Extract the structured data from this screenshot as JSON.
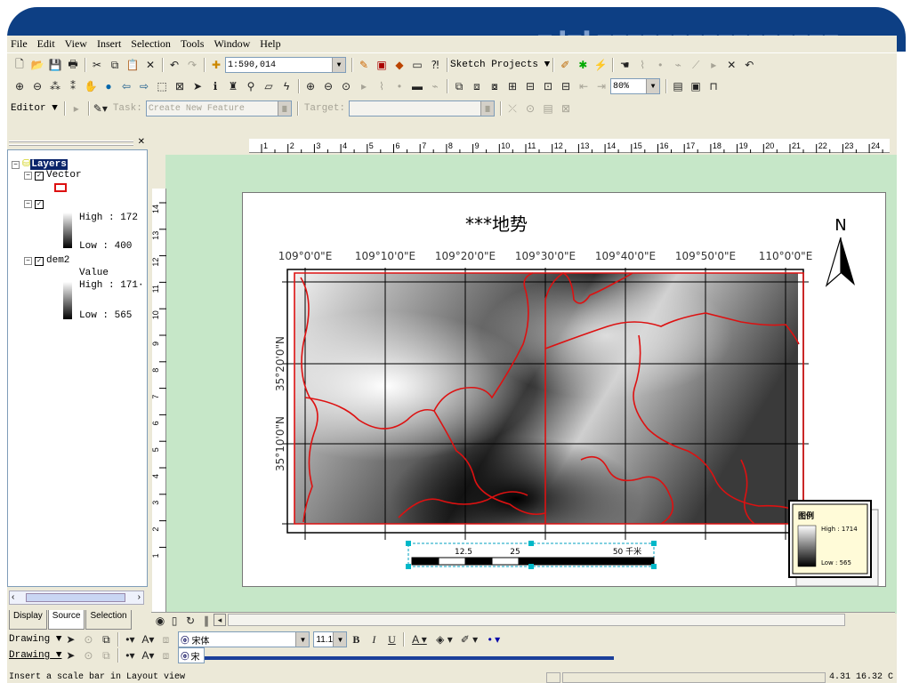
{
  "menu": [
    "File",
    "Edit",
    "View",
    "Insert",
    "Selection",
    "Tools",
    "Window",
    "Help"
  ],
  "standard_toolbar": {
    "scale": "1:590,014",
    "sketch_label": "Sketch Projects"
  },
  "layout_toolbar": {
    "zoom": "80%"
  },
  "editor_toolbar": {
    "editor_label": "Editor",
    "task_label": "Task:",
    "task_value": "Create New Feature",
    "target_label": "Target:"
  },
  "toc": {
    "root": "Layers",
    "vector": "Vector",
    "raster1_high": "High : 172",
    "raster1_low": "Low : 400",
    "dem": "dem2",
    "dem_value": "Value",
    "dem_high": "High : 171·",
    "dem_low": "Low : 565",
    "tabs": [
      "Display",
      "Source",
      "Selection"
    ]
  },
  "ruler_h": [
    "1",
    "2",
    "3",
    "4",
    "5",
    "6",
    "7",
    "8",
    "9",
    "10",
    "11",
    "12",
    "13",
    "14",
    "15",
    "16",
    "17",
    "18",
    "19",
    "20",
    "21",
    "22",
    "23",
    "24"
  ],
  "ruler_v": [
    "14",
    "13",
    "12",
    "11",
    "10",
    "9",
    "8",
    "7",
    "6",
    "5",
    "4",
    "3",
    "2",
    "1"
  ],
  "map": {
    "title": "***地势",
    "lon_labels": [
      "109°0'0\"E",
      "109°10'0\"E",
      "109°20'0\"E",
      "109°30'0\"E",
      "109°40'0\"E",
      "109°50'0\"E",
      "110°0'0\"E"
    ],
    "lat_labels": [
      "35°20'0\"N",
      "35°10'0\"N"
    ],
    "north": "N",
    "scale_labels": [
      "12.5",
      "25",
      "50 千米"
    ],
    "legend": {
      "title": "图例",
      "high": "High : 1714",
      "low": "Low : 565"
    }
  },
  "drawing_toolbar": {
    "drawing_label": "Drawing",
    "font": "宋体",
    "size": "11.1",
    "font2": "宋"
  },
  "status": {
    "message": "Insert a scale bar in Layout view",
    "coords": "4.31  16.32 C"
  },
  "colors": {
    "title_blue": "#0d3f84",
    "app_bg": "#ece9d8",
    "layout_green": "#c6e7c8",
    "boundary_red": "#dd1111"
  }
}
